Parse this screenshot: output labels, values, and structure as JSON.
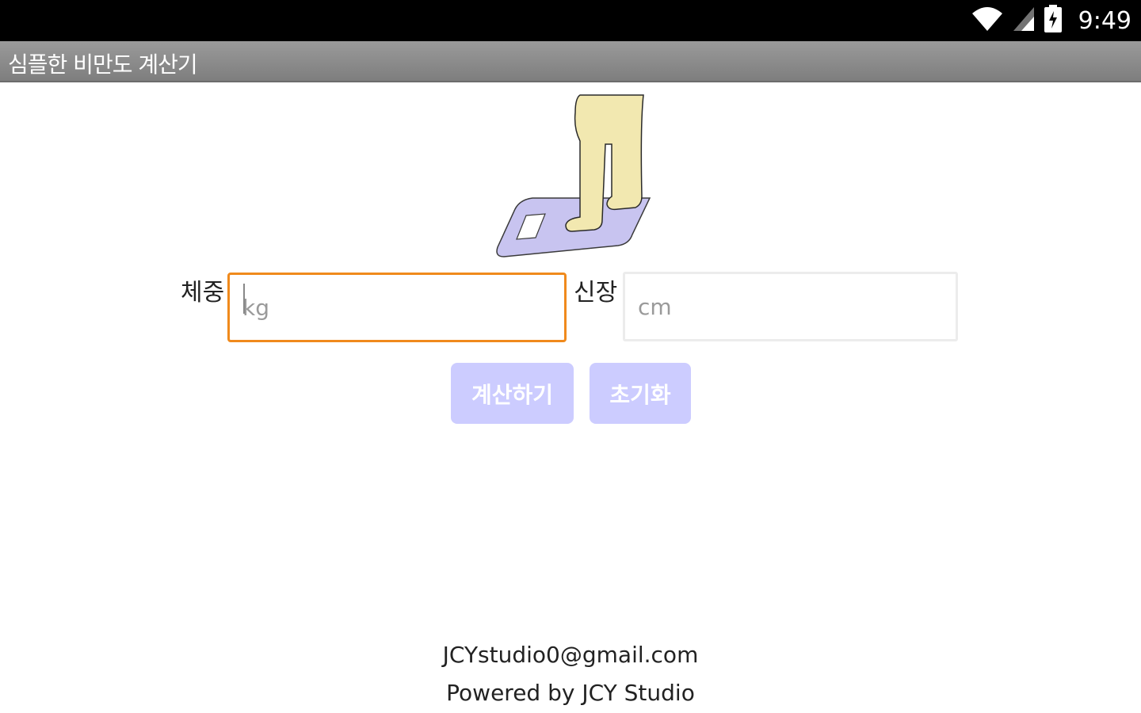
{
  "status_bar": {
    "time": "9:49",
    "icons": [
      "wifi-icon",
      "cellular-signal-icon",
      "battery-charging-icon"
    ]
  },
  "app": {
    "title": "심플한 비만도 계산기"
  },
  "form": {
    "weight_label": "체중",
    "weight_placeholder": "kg",
    "weight_value": "",
    "height_label": "신장",
    "height_placeholder": "cm",
    "height_value": ""
  },
  "buttons": {
    "calculate": "계산하기",
    "reset": "초기화"
  },
  "footer": {
    "email": "JCYstudio0@gmail.com",
    "powered_by": "Powered by JCY Studio"
  },
  "colors": {
    "status_bar": "#000000",
    "title_bar": "#8a8a8a",
    "focused_border": "#f08a1c",
    "button_bg": "#ccccff",
    "scale_fill": "#c8c4f0",
    "legs_fill": "#f2e8b0"
  }
}
